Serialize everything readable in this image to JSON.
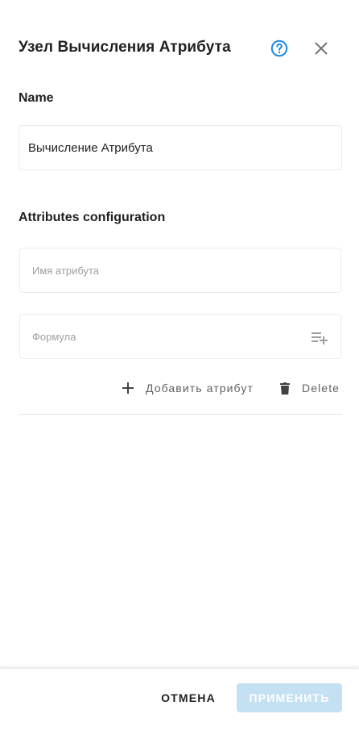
{
  "dialog": {
    "title": "Узел Вычисления Атрибута",
    "help_icon": "help-circle-icon",
    "close_icon": "close-icon"
  },
  "name_section": {
    "label": "Name",
    "value": "Вычисление Атрибута"
  },
  "attributes_section": {
    "label": "Attributes configuration",
    "attribute_name_placeholder": "Имя атрибута",
    "formula_placeholder": "Формула",
    "formula_icon": "playlist-add-icon",
    "add_label": "Добавить атрибут",
    "add_icon": "plus-icon",
    "delete_label": "Delete",
    "delete_icon": "trash-icon"
  },
  "footer": {
    "cancel_label": "ОТМЕНА",
    "apply_label": "ПРИМЕНИТЬ"
  },
  "colors": {
    "accent": "#1e88e5",
    "apply_disabled_bg": "#c4e1f4",
    "icon_gray": "#757575"
  }
}
